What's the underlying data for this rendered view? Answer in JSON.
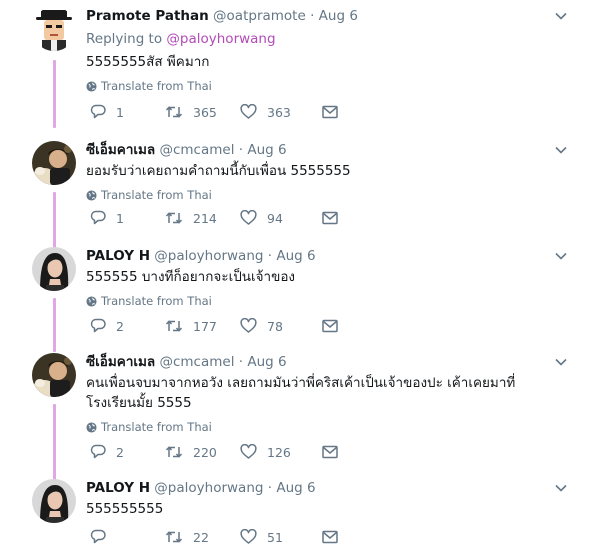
{
  "tweets": [
    {
      "name": "Pramote Pathan",
      "handle": "@oatpramote",
      "dot": "·",
      "time": "Aug 6",
      "replying_prefix": "Replying to ",
      "replying_handle": "@paloyhorwang",
      "text": "5555555สัส พีคมาก",
      "translate": "Translate from Thai",
      "replies": "1",
      "retweets": "365",
      "likes": "363"
    },
    {
      "name": "ซีเอ็มคาเมล",
      "handle": "@cmcamel",
      "dot": "·",
      "time": "Aug 6",
      "text": "ยอมรับว่าเคยถามคำถามนี้กับเพื่อน 5555555",
      "translate": "Translate from Thai",
      "replies": "1",
      "retweets": "214",
      "likes": "94"
    },
    {
      "name": "PALOY H",
      "handle": "@paloyhorwang",
      "dot": "·",
      "time": "Aug 6",
      "text": "555555 บางทีก็อยากจะเป็นเจ้าของ",
      "translate": "Translate from Thai",
      "replies": "2",
      "retweets": "177",
      "likes": "78"
    },
    {
      "name": "ซีเอ็มคาเมล",
      "handle": "@cmcamel",
      "dot": "·",
      "time": "Aug 6",
      "text": "คนเพื่อนจบมาจากหอวัง เลยถามมันว่าพี่คริสเค้าเป็นเจ้าของปะ เค้าเคยมาที่โรงเรียนมั้ย 5555",
      "translate": "Translate from Thai",
      "replies": "2",
      "retweets": "220",
      "likes": "126"
    },
    {
      "name": "PALOY H",
      "handle": "@paloyhorwang",
      "dot": "·",
      "time": "Aug 6",
      "text": "555555555",
      "replies": "",
      "retweets": "22",
      "likes": "51"
    }
  ],
  "colors": {
    "thread_line": "#e2a6e6",
    "link": "#b34bb8",
    "muted": "#657786"
  },
  "icons": [
    "reply-icon",
    "retweet-icon",
    "like-icon",
    "dm-icon",
    "translate-globe-icon",
    "chevron-down-icon"
  ]
}
